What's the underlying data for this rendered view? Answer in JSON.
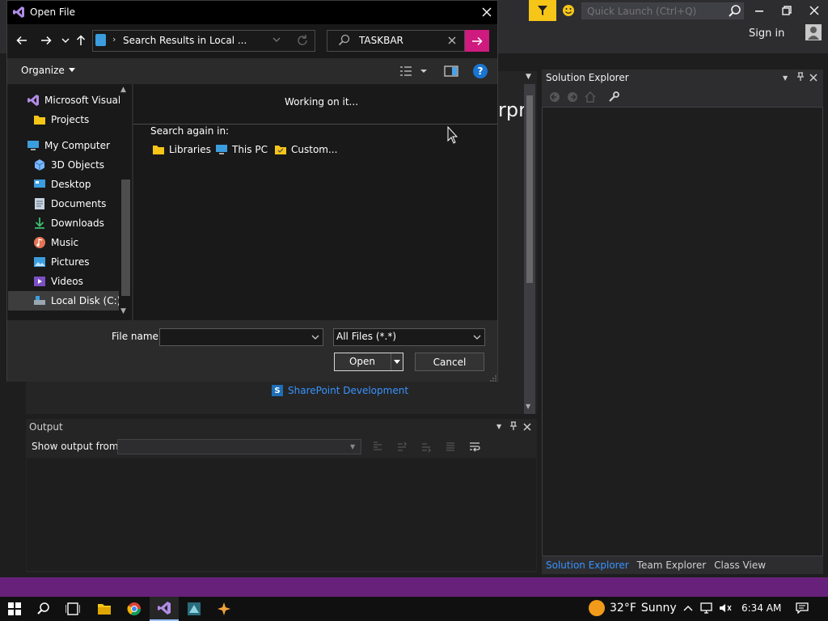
{
  "vs": {
    "quick_launch_placeholder": "Quick Launch (Ctrl+Q)",
    "sign_in": "Sign in",
    "doc_title_fragment": "rpr",
    "sharepoint_link": "SharePoint Development",
    "sharepoint_icon_letter": "S",
    "solution_explorer_title": "Solution Explorer",
    "bottom_tabs": [
      "Solution Explorer",
      "Team Explorer",
      "Class View"
    ],
    "output_title": "Output",
    "show_output_from": "Show output from:",
    "status_color": "#68217a",
    "accent": "#3794ff"
  },
  "dialog": {
    "title": "Open File",
    "address_separator": "›",
    "address_text": "Search Results in Local ...",
    "search_text": "TASKBAR",
    "organize": "Organize",
    "help_glyph": "?",
    "working": "Working on it...",
    "search_again_label": "Search again in:",
    "search_again_items": [
      "Libraries",
      "This PC",
      "Custom..."
    ],
    "tree": [
      {
        "label": "Microsoft Visual S",
        "icon": "visual-studio-icon"
      },
      {
        "label": "Projects",
        "icon": "folder-icon"
      },
      {
        "label": "My Computer",
        "icon": "computer-icon"
      },
      {
        "label": "3D Objects",
        "icon": "cube-icon"
      },
      {
        "label": "Desktop",
        "icon": "desktop-icon"
      },
      {
        "label": "Documents",
        "icon": "document-icon"
      },
      {
        "label": "Downloads",
        "icon": "download-icon"
      },
      {
        "label": "Music",
        "icon": "music-icon"
      },
      {
        "label": "Pictures",
        "icon": "pictures-icon"
      },
      {
        "label": "Videos",
        "icon": "videos-icon"
      },
      {
        "label": "Local Disk (C:)",
        "icon": "drive-icon"
      }
    ],
    "file_name_label": "File name:",
    "file_name_value": "",
    "file_type": "All Files (*.*)",
    "open_label": "Open",
    "cancel_label": "Cancel",
    "search_go_color": "#cf1a7f"
  },
  "taskbar": {
    "weather_temp": "32°F",
    "weather_desc": "Sunny",
    "clock": "6:34 AM"
  }
}
